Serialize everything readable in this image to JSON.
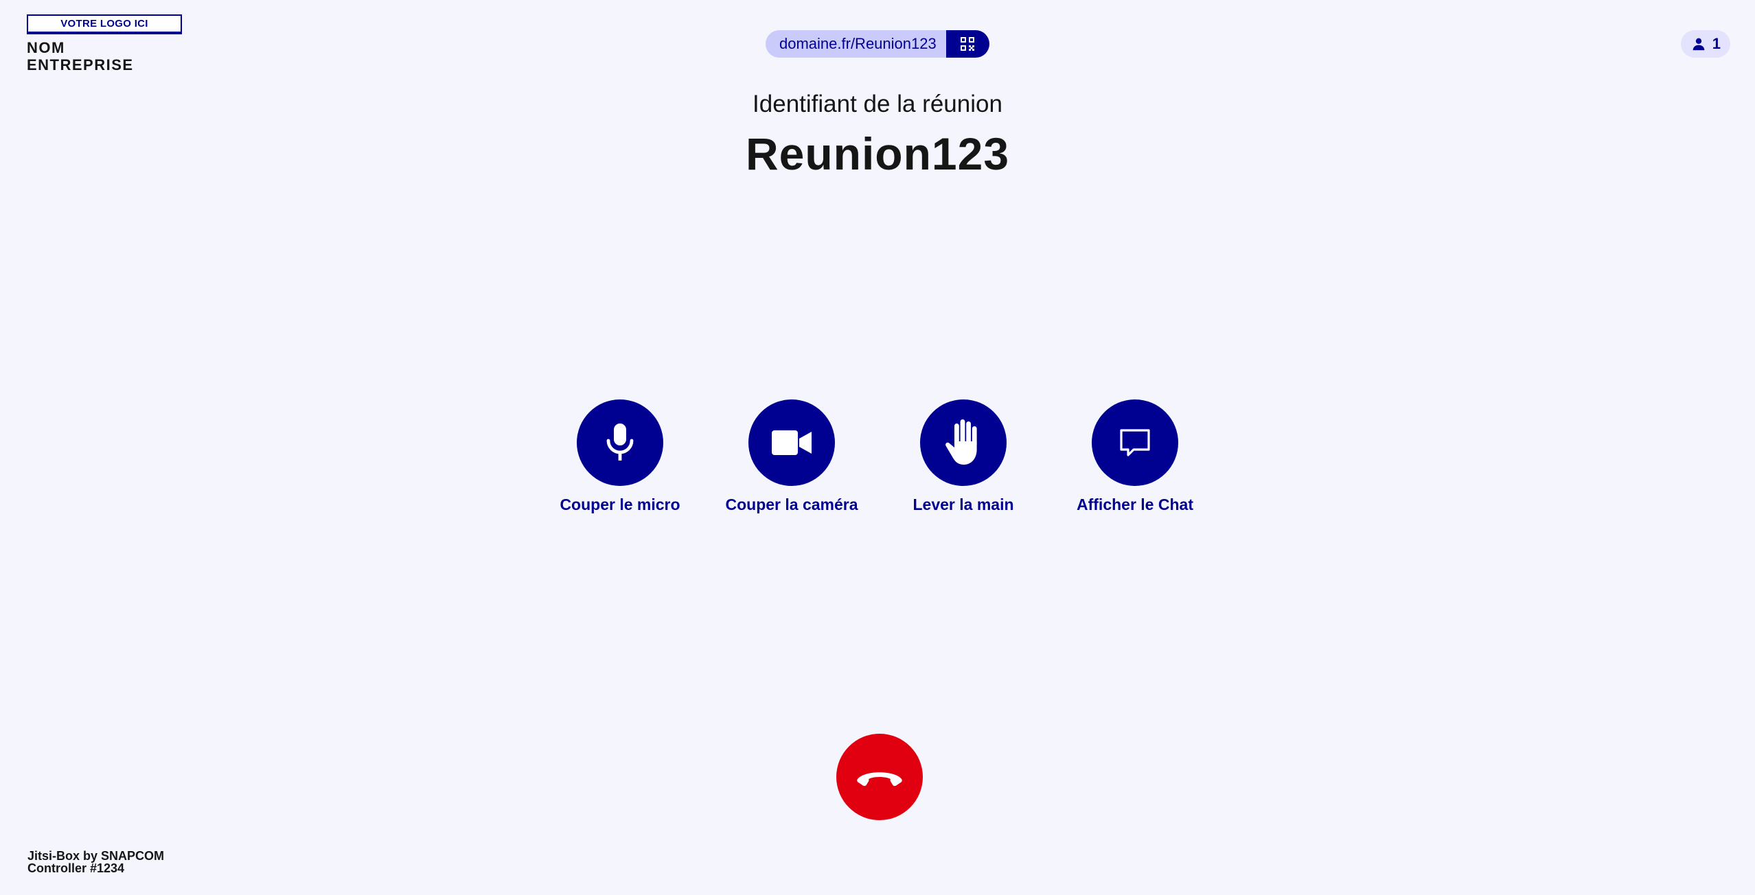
{
  "brand": {
    "logo_text": "VOTRE LOGO ICI",
    "company_line1": "NOM",
    "company_line2": "ENTREPRISE"
  },
  "header": {
    "url": "domaine.fr/Reunion123",
    "participant_count": "1"
  },
  "meeting": {
    "label": "Identifiant de la réunion",
    "id": "Reunion123"
  },
  "controls": [
    {
      "label": "Couper le micro",
      "icon": "microphone-icon"
    },
    {
      "label": "Couper la caméra",
      "icon": "video-camera-icon"
    },
    {
      "label": "Lever la main",
      "icon": "raise-hand-icon"
    },
    {
      "label": "Afficher le Chat",
      "icon": "chat-bubble-icon"
    }
  ],
  "hangup": {
    "icon": "hang-up-phone-icon"
  },
  "footer": {
    "line1": "Jitsi-Box by SNAPCOM",
    "line2": "Controller #1234"
  },
  "colors": {
    "background": "#f4f5fd",
    "primary": "#000091",
    "url_pill": "#cacafb",
    "participant_pill": "#e3e3fd",
    "hangup": "#e1000f"
  }
}
